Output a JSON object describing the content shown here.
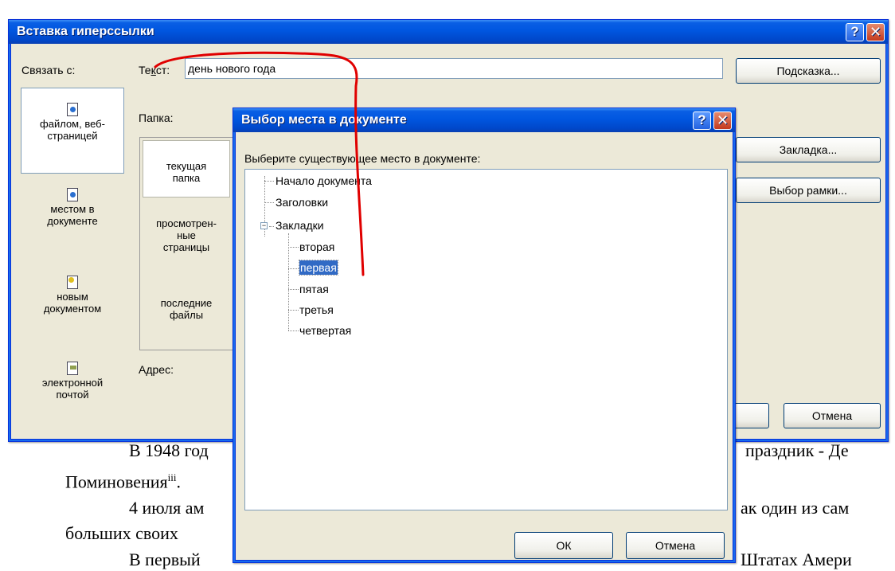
{
  "document": {
    "line1": "В 1948 год",
    "line1_right": "праздник - Де",
    "line2": "Поминовения",
    "line2_sup": "iii",
    "line2_end": ".",
    "line3": "4 июля ам",
    "line3_right": "ак один из сам",
    "line4": "больших своих",
    "line5": "В первый",
    "line5_right": "Штатах Амери"
  },
  "outer_dialog": {
    "title": "Вставка гиперссылки",
    "link_to_label": "Связать с:",
    "text_label": "Текст:",
    "text_value": "день нового года",
    "screentip_button": "Подсказка...",
    "folder_label": "Папка:",
    "bookmark_button": "Закладка...",
    "target_frame_button": "Выбор рамки...",
    "address_label": "Адрес:",
    "cancel_button": "Отмена",
    "link_items": [
      {
        "label_1": "файлом, веб-",
        "label_2": "страницей",
        "icon": "web-page-icon"
      },
      {
        "label_1": "местом в",
        "label_2": "документе",
        "icon": "place-in-document-icon"
      },
      {
        "label_1": "новым",
        "label_2": "документом",
        "icon": "new-document-icon"
      },
      {
        "label_1": "электронной",
        "label_2": "почтой",
        "icon": "email-icon"
      }
    ],
    "folder_items": [
      {
        "label_1": "текущая",
        "label_2": "папка"
      },
      {
        "label_1": "просмотрен-",
        "label_2": "ные",
        "label_3": "страницы"
      },
      {
        "label_1": "последние",
        "label_2": "файлы"
      }
    ]
  },
  "inner_dialog": {
    "title": "Выбор места в документе",
    "prompt": "Выберите существующее место в документе:",
    "tree": [
      {
        "label": "Начало документа"
      },
      {
        "label": "Заголовки"
      },
      {
        "label": "Закладки",
        "expanded": true
      },
      {
        "label": "вторая"
      },
      {
        "label": "первая",
        "selected": true
      },
      {
        "label": "пятая"
      },
      {
        "label": "третья"
      },
      {
        "label": "четвертая"
      }
    ],
    "ok_button": "ОК",
    "cancel_button": "Отмена"
  },
  "colors": {
    "titlebar": "#0054e3",
    "dialog_bg": "#ece9d8",
    "selection": "#316ac5",
    "annotation": "#e00000"
  }
}
